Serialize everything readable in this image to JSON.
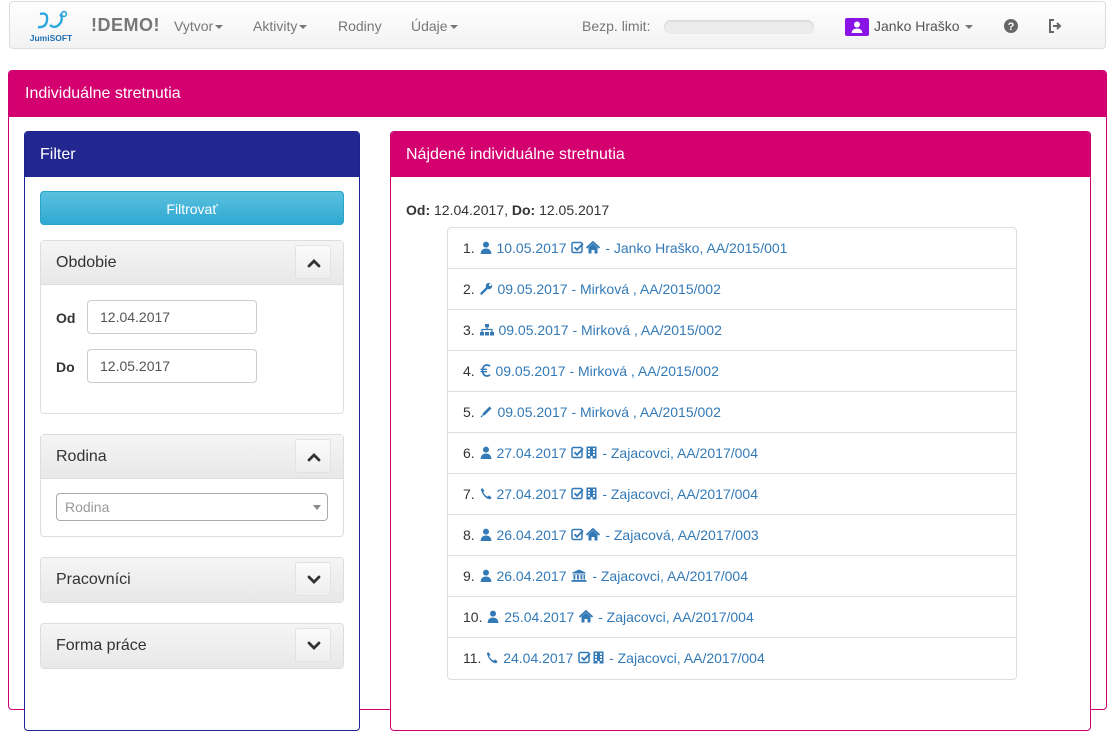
{
  "navbar": {
    "brand_logo_text": "JumiSOFT",
    "brand": "!DEMO!",
    "menu": [
      {
        "label": "Vytvor",
        "dropdown": true
      },
      {
        "label": "Aktivity",
        "dropdown": true
      },
      {
        "label": "Rodiny",
        "dropdown": false
      },
      {
        "label": "Údaje",
        "dropdown": true
      }
    ],
    "limit_label": "Bezp. limit:",
    "limit_progress": 0,
    "user_name": "Janko Hraško",
    "user_icon": "user-icon",
    "help_icon": "question-circle-icon",
    "logout_icon": "sign-out-icon"
  },
  "page": {
    "title": "Individuálne stretnutia"
  },
  "filter": {
    "title": "Filter",
    "button_label": "Filtrovať",
    "sections": {
      "obdobie": {
        "title": "Obdobie",
        "from_label": "Od",
        "from_value": "12.04.2017",
        "to_label": "Do",
        "to_value": "12.05.2017"
      },
      "rodina": {
        "title": "Rodina",
        "placeholder": "Rodina"
      },
      "pracovnici": {
        "title": "Pracovníci"
      },
      "forma": {
        "title": "Forma práce"
      }
    }
  },
  "results": {
    "title": "Nájdené individuálne stretnutia",
    "from_label": "Od:",
    "from_value": "12.04.2017",
    "sep": ",",
    "to_label": "Do:",
    "to_value": "12.05.2017",
    "items": [
      {
        "num": "1.",
        "icon": "user",
        "date": "10.05.2017",
        "tail_icons": [
          "check-square",
          "home"
        ],
        "text": "- Janko Hraško, AA/2015/001"
      },
      {
        "num": "2.",
        "icon": "wrench",
        "date": "09.05.2017",
        "tail_icons": [],
        "text": "- Mirková , AA/2015/002"
      },
      {
        "num": "3.",
        "icon": "sitemap",
        "date": "09.05.2017",
        "tail_icons": [],
        "text": "- Mirková , AA/2015/002"
      },
      {
        "num": "4.",
        "icon": "euro",
        "date": "09.05.2017",
        "tail_icons": [],
        "text": "- Mirková , AA/2015/002"
      },
      {
        "num": "5.",
        "icon": "pencil",
        "date": "09.05.2017",
        "tail_icons": [],
        "text": "- Mirková , AA/2015/002"
      },
      {
        "num": "6.",
        "icon": "user",
        "date": "27.04.2017",
        "tail_icons": [
          "check-square",
          "building"
        ],
        "text": "- Zajacovci, AA/2017/004"
      },
      {
        "num": "7.",
        "icon": "phone",
        "date": "27.04.2017",
        "tail_icons": [
          "check-square",
          "building"
        ],
        "text": "- Zajacovci, AA/2017/004"
      },
      {
        "num": "8.",
        "icon": "user",
        "date": "26.04.2017",
        "tail_icons": [
          "check-square",
          "home"
        ],
        "text": "- Zajacová, AA/2017/003"
      },
      {
        "num": "9.",
        "icon": "user",
        "date": "26.04.2017",
        "tail_icons": [
          "bank"
        ],
        "text": "- Zajacovci, AA/2017/004"
      },
      {
        "num": "10.",
        "icon": "user",
        "date": "25.04.2017",
        "tail_icons": [
          "home"
        ],
        "text": "- Zajacovci, AA/2017/004"
      },
      {
        "num": "11.",
        "icon": "phone",
        "date": "24.04.2017",
        "tail_icons": [
          "check-square",
          "building"
        ],
        "text": "- Zajacovci, AA/2017/004"
      }
    ]
  },
  "colors": {
    "accent_magenta": "#d4006f",
    "filter_navy": "#22278f",
    "link_blue": "#337ab7",
    "button_cyan": "#5bc0de",
    "user_badge_purple": "#8a14e6"
  }
}
